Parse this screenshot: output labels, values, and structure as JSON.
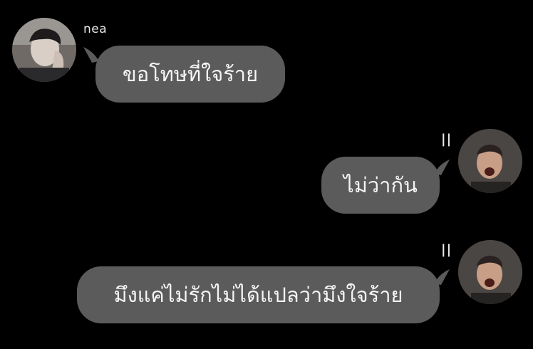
{
  "conversation": {
    "messages": [
      {
        "side": "left",
        "sender": "nea",
        "text": "ขอโทษที่ใจร้าย",
        "avatar_icon": "avatar-photo-nea"
      },
      {
        "side": "right",
        "status": "||",
        "text": "ไม่ว่ากัน",
        "avatar_icon": "avatar-photo-self"
      },
      {
        "side": "right",
        "status": "||",
        "text": "มึงแค่ไม่รักไม่ได้แปลว่ามึงใจร้าย",
        "avatar_icon": "avatar-photo-self"
      }
    ]
  },
  "colors": {
    "background": "#000000",
    "bubble": "#5b5b5b",
    "text": "#f5f5f5"
  }
}
